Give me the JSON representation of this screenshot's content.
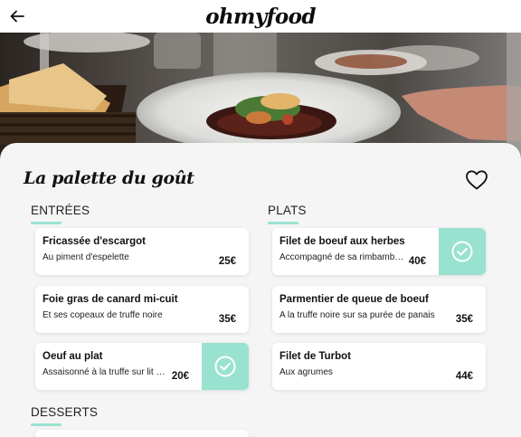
{
  "header": {
    "logo": "ohmyfood",
    "back_icon": "arrow-left-icon"
  },
  "hero": {
    "description_icon": "restaurant-dish-photo"
  },
  "restaurant": {
    "name": "La palette du goût",
    "favorite_icon": "heart-outline-icon"
  },
  "sections": {
    "entrees": {
      "title": "ENTRÉES",
      "items": [
        {
          "name": "Fricassée d'escargot",
          "desc": "Au piment d'espelette",
          "price": "25€",
          "selected": false
        },
        {
          "name": "Foie gras de canard mi-cuit",
          "desc": "Et ses copeaux de truffe noire",
          "price": "35€",
          "selected": false
        },
        {
          "name": "Oeuf au plat",
          "desc": "Assaisonné à la truffe sur lit de pain grillé",
          "price": "20€",
          "selected": true
        }
      ]
    },
    "plats": {
      "title": "PLATS",
      "items": [
        {
          "name": "Filet de boeuf aux herbes",
          "desc": "Accompagné de sa rimbambelle de légumes",
          "price": "40€",
          "selected": true
        },
        {
          "name": "Parmentier de queue de boeuf",
          "desc": "A la truffe noire sur sa purée de panais",
          "price": "35€",
          "selected": false
        },
        {
          "name": "Filet de Turbot",
          "desc": "Aux agrumes",
          "price": "44€",
          "selected": false
        }
      ]
    },
    "desserts": {
      "title": "DESSERTS"
    }
  },
  "colors": {
    "accent": "#99e2d0",
    "background": "#f5f5f5",
    "card": "#ffffff"
  }
}
